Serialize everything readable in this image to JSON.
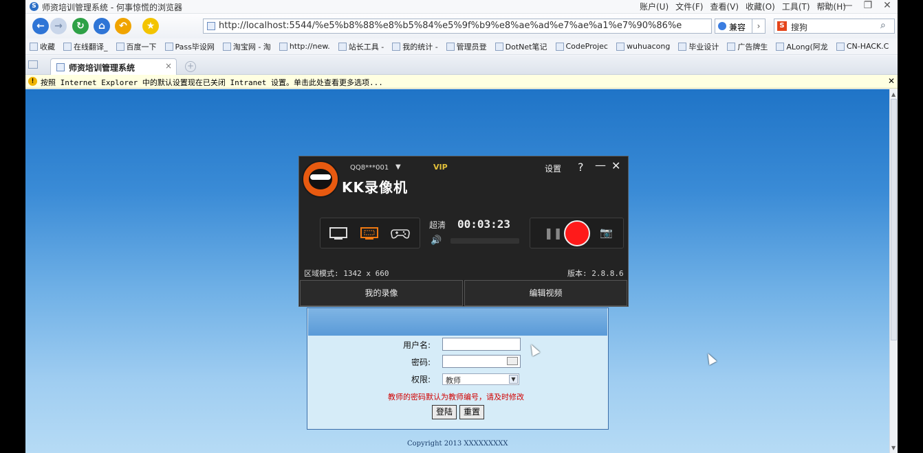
{
  "browser": {
    "title": "师资培训管理系统 - 何事惊慌的浏览器",
    "menus": [
      "账户(U)",
      "文件(F)",
      "查看(V)",
      "收藏(O)",
      "工具(T)",
      "帮助(H)"
    ],
    "address": "http://localhost:5544/%e5%b8%88%e8%b5%84%e5%9f%b9%e8%ae%ad%e7%ae%a1%e7%90%86%e",
    "compat_label": "兼容",
    "search_placeholder": "搜狗",
    "favorites": [
      "收藏",
      "在线翻译_",
      "百度一下",
      "Pass毕设网",
      "淘宝网 - 淘",
      "http://new.",
      "站长工具 -",
      "我的统计 -",
      "管理员登",
      "DotNet笔记",
      "CodeProjec",
      "wuhuacong",
      "毕业设计",
      "广告牌生",
      "ALong(阿龙",
      "CN-HACK.C"
    ],
    "tab_title": "师资培训管理系统",
    "infobar_text": "按照 Internet Explorer 中的默认设置现在已关闭 Intranet 设置。单击此处查看更多选项..."
  },
  "login": {
    "username_label": "用户名:",
    "password_label": "密码:",
    "role_label": "权限:",
    "role_value": "教师",
    "hint": "教师的密码默认为教师编号，请及时修改",
    "login_button": "登陆",
    "reset_button": "重置",
    "copyright": "Copyright 2013 XXXXXXXXX"
  },
  "recorder": {
    "brand": "KK录像机",
    "user": "QQ8***001",
    "vip": "VIP",
    "settings": "设置",
    "help": "?",
    "quality": "超清",
    "timer": "00:03:23",
    "region": "区域模式: 1342 x 660",
    "version": "版本: 2.8.8.6",
    "my_videos": "我的录像",
    "edit_video": "编辑视频"
  },
  "colors": {
    "page_blue_top": "#1f74c7",
    "record_red": "#ff1a1a",
    "hint_red": "#d10000",
    "vip_gold": "#e3c13a"
  }
}
